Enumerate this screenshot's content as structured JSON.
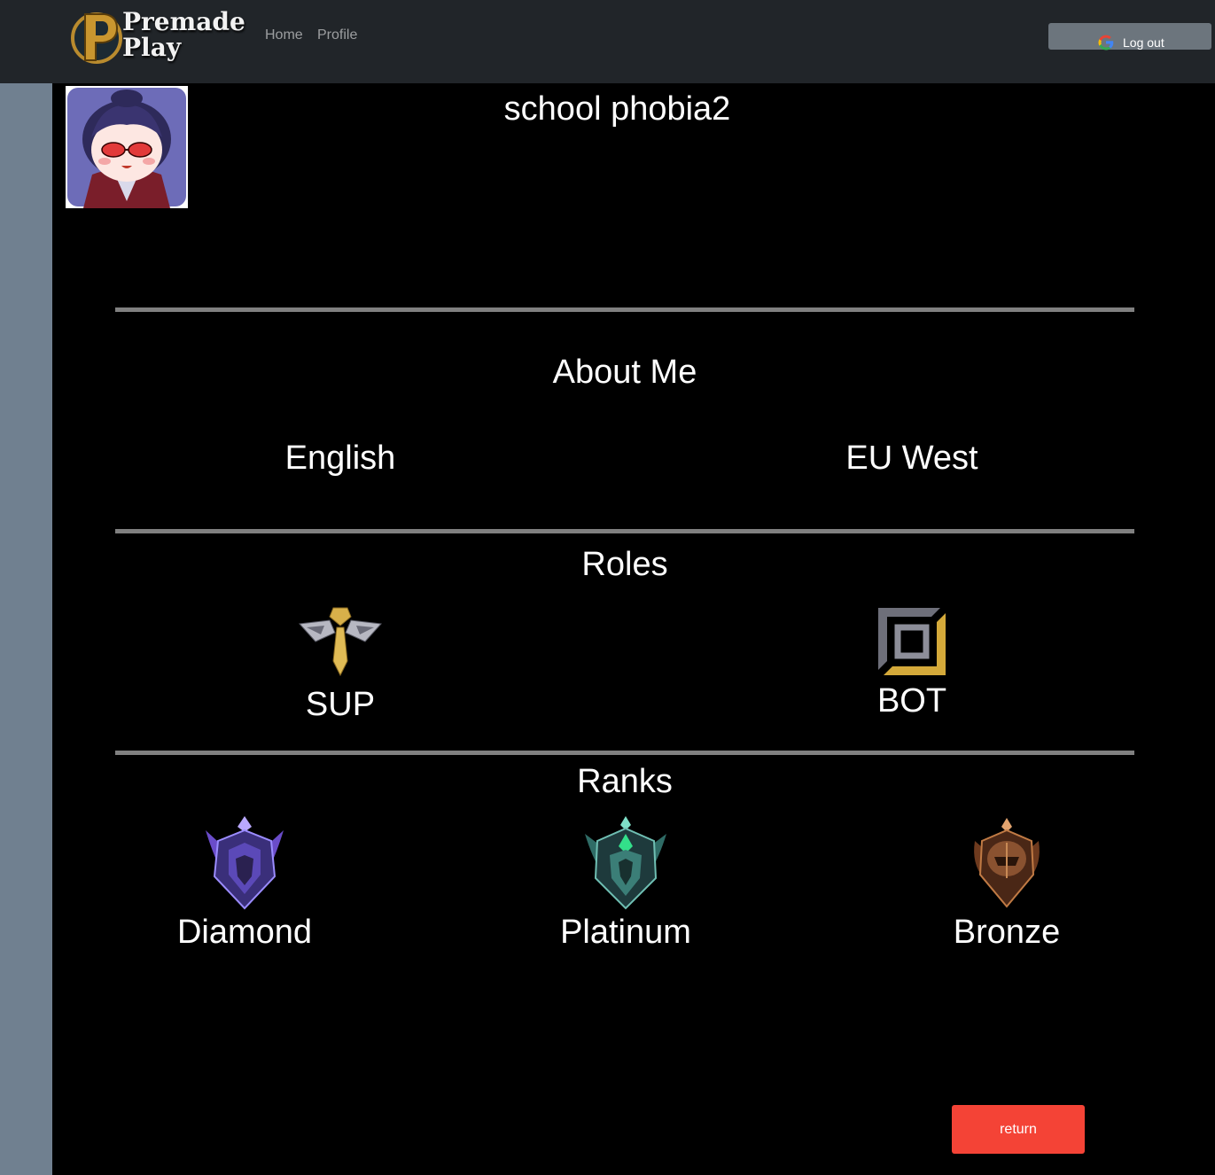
{
  "navbar": {
    "brand_line1": "Premade",
    "brand_line2": "Play",
    "links": [
      "Home",
      "Profile"
    ],
    "logout_label": "Log out"
  },
  "profile": {
    "username": "school phobia2",
    "about_heading": "About Me",
    "language": "English",
    "region": "EU West",
    "roles_heading": "Roles",
    "roles": [
      {
        "label": "SUP",
        "icon": "support-role-icon"
      },
      {
        "label": "BOT",
        "icon": "bot-lane-role-icon"
      }
    ],
    "ranks_heading": "Ranks",
    "ranks": [
      {
        "label": "Diamond",
        "icon": "diamond-rank-icon",
        "color": "#6b5bd6"
      },
      {
        "label": "Platinum",
        "icon": "platinum-rank-icon",
        "color": "#3aa89a"
      },
      {
        "label": "Bronze",
        "icon": "bronze-rank-icon",
        "color": "#a0643c"
      }
    ],
    "return_label": "return"
  },
  "colors": {
    "navbar_bg": "#212529",
    "page_bg": "#708090",
    "content_bg": "#000000",
    "return_button": "#f44336",
    "logout_button": "#6c757d"
  }
}
